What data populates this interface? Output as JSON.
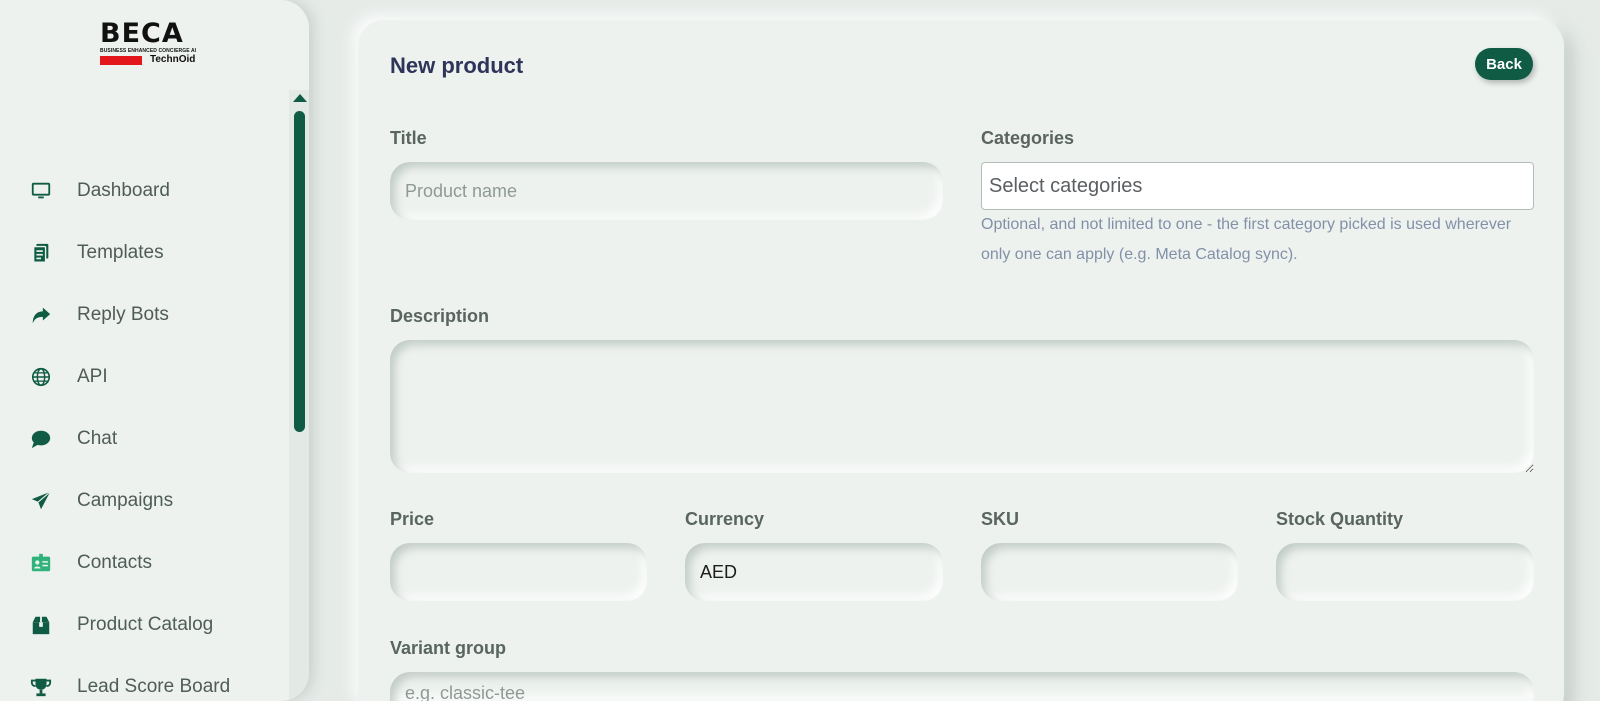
{
  "logo": {
    "name": "BECA",
    "tagline": "BUSINESS ENHANCED CONCIERGE AI",
    "partner": "TechnOid"
  },
  "sidebar": {
    "items": [
      {
        "label": "Dashboard",
        "icon": "monitor-icon"
      },
      {
        "label": "Templates",
        "icon": "document-icon"
      },
      {
        "label": "Reply Bots",
        "icon": "reply-arrow-icon"
      },
      {
        "label": "API",
        "icon": "globe-icon"
      },
      {
        "label": "Chat",
        "icon": "chat-bubble-icon"
      },
      {
        "label": "Campaigns",
        "icon": "paper-plane-icon"
      },
      {
        "label": "Contacts",
        "icon": "contact-card-icon"
      },
      {
        "label": "Product Catalog",
        "icon": "box-icon"
      },
      {
        "label": "Lead Score Board",
        "icon": "trophy-icon"
      }
    ]
  },
  "page": {
    "title": "New product",
    "back_label": "Back"
  },
  "form": {
    "title_label": "Title",
    "title_placeholder": "Product name",
    "title_value": "",
    "categories_label": "Categories",
    "categories_placeholder": "Select categories",
    "categories_help": "Optional, and not limited to one - the first category picked is used wherever only one can apply (e.g. Meta Catalog sync).",
    "description_label": "Description",
    "description_value": "",
    "price_label": "Price",
    "price_value": "",
    "currency_label": "Currency",
    "currency_value": "AED",
    "sku_label": "SKU",
    "sku_value": "",
    "stock_label": "Stock Quantity",
    "stock_value": "",
    "variant_label": "Variant group",
    "variant_placeholder": "e.g. classic-tee"
  },
  "colors": {
    "accent": "#0f5b43",
    "background": "#eef2ef",
    "title": "#2e3559",
    "help_text": "#8290a8"
  }
}
